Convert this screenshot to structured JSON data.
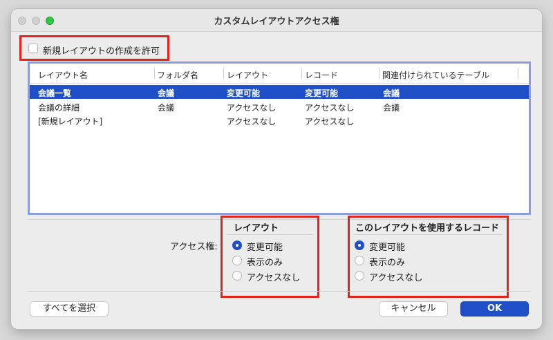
{
  "window": {
    "title": "カスタムレイアウトアクセス権"
  },
  "allow_new_layout": {
    "label": "新規レイアウトの作成を許可",
    "checked": false
  },
  "table": {
    "columns": [
      "レイアウト名",
      "フォルダ名",
      "レイアウト",
      "レコード",
      "関連付けられているテーブル"
    ],
    "rows": [
      [
        "会議一覧",
        "会議",
        "変更可能",
        "変更可能",
        "会議"
      ],
      [
        "会議の詳細",
        "会議",
        "アクセスなし",
        "アクセスなし",
        "会議"
      ],
      [
        "[新規レイアウト]",
        "",
        "アクセスなし",
        "アクセスなし",
        ""
      ]
    ],
    "selected_row": 0
  },
  "access": {
    "label": "アクセス権:",
    "layout_group": {
      "title": "レイアウト",
      "options": [
        "変更可能",
        "表示のみ",
        "アクセスなし"
      ],
      "selected": 0
    },
    "record_group": {
      "title": "このレイアウトを使用するレコード",
      "options": [
        "変更可能",
        "表示のみ",
        "アクセスなし"
      ],
      "selected": 0
    }
  },
  "buttons": {
    "select_all": "すべてを選択",
    "cancel": "キャンセル",
    "ok": "OK"
  },
  "colors": {
    "accent": "#1f4fc6",
    "highlight_border": "#e1251b",
    "table_border": "#8b9ce0"
  }
}
